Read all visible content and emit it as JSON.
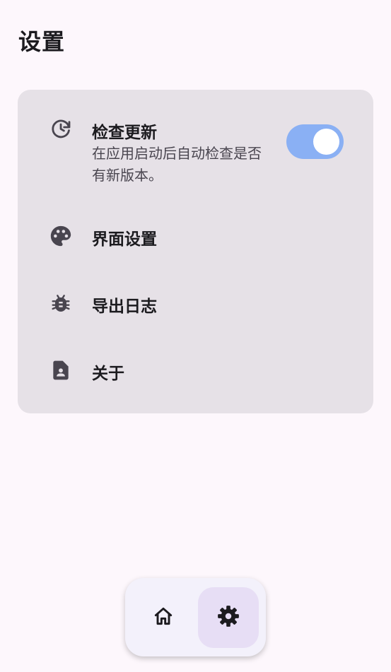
{
  "header": {
    "title": "设置"
  },
  "settings": {
    "items": [
      {
        "icon": "update-icon",
        "title": "检查更新",
        "description": "在应用启动后自动检查是否有新版本。",
        "toggle_on": true
      },
      {
        "icon": "palette-icon",
        "title": "界面设置"
      },
      {
        "icon": "bug-icon",
        "title": "导出日志"
      },
      {
        "icon": "contact-page-icon",
        "title": "关于"
      }
    ]
  },
  "bottom_nav": {
    "items": [
      {
        "icon": "home-icon",
        "selected": false
      },
      {
        "icon": "settings-gear-icon",
        "selected": true
      }
    ]
  },
  "colors": {
    "background": "#fdf7fc",
    "card": "#e6e1e7",
    "toggle_track": "#8ab0f4",
    "nav_selected": "#e7def5"
  }
}
